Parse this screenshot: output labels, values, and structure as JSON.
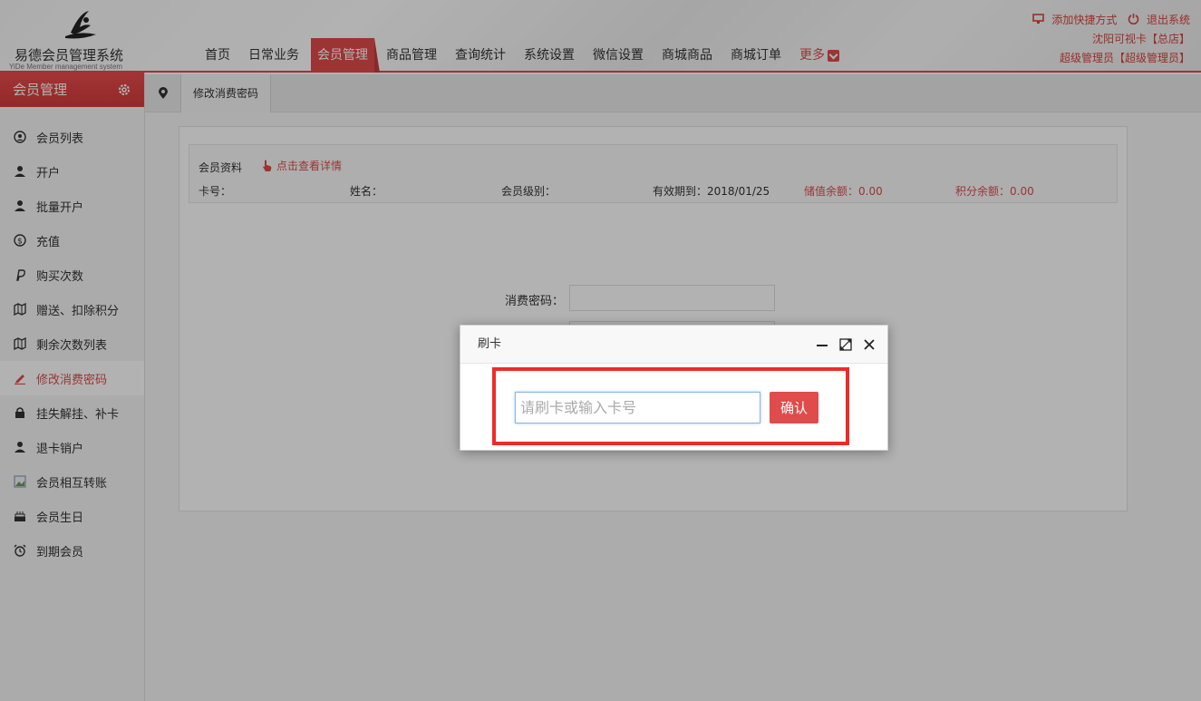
{
  "app": {
    "title": "易德会员管理系统",
    "subtitle": "YiDe Member management system"
  },
  "nav": {
    "items": [
      "首页",
      "日常业务",
      "会员管理",
      "商品管理",
      "查询统计",
      "系统设置",
      "微信设置",
      "商城商品",
      "商城订单"
    ],
    "active": "会员管理",
    "more": "更多"
  },
  "top_right": {
    "shortcut": "添加快捷方式",
    "logout": "退出系统",
    "store": "沈阳可视卡【总店】",
    "user": "超级管理员【超级管理员】"
  },
  "sidebar": {
    "title": "会员管理",
    "items": [
      {
        "label": "会员列表",
        "icon": "user-circle-icon"
      },
      {
        "label": "开户",
        "icon": "user-icon"
      },
      {
        "label": "批量开户",
        "icon": "user-icon"
      },
      {
        "label": "充值",
        "icon": "dollar-circle-icon"
      },
      {
        "label": "购买次数",
        "icon": "paypal-icon"
      },
      {
        "label": "赠送、扣除积分",
        "icon": "map-icon"
      },
      {
        "label": "剩余次数列表",
        "icon": "map-icon"
      },
      {
        "label": "修改消费密码",
        "icon": "pencil-icon",
        "active": true
      },
      {
        "label": "挂失解挂、补卡",
        "icon": "lock-icon"
      },
      {
        "label": "退卡销户",
        "icon": "user-icon"
      },
      {
        "label": "会员相互转账",
        "icon": "image-icon"
      },
      {
        "label": "会员生日",
        "icon": "cake-icon"
      },
      {
        "label": "到期会员",
        "icon": "alarm-icon"
      }
    ]
  },
  "tab": {
    "label": "修改消费密码"
  },
  "member_info": {
    "title": "会员资料",
    "detail_link": "点击查看详情",
    "card_no": "卡号：",
    "name": "姓名：",
    "level": "会员级别：",
    "expiry": "有效期到：2018/01/25",
    "stored_balance": "储值余额：0.00",
    "points_balance": "积分余额：0.00"
  },
  "form": {
    "password_label": "消费密码："
  },
  "dialog": {
    "title": "刷卡",
    "input_placeholder": "请刷卡或输入卡号",
    "confirm": "确认"
  },
  "colors": {
    "accent": "#e04b4b",
    "highlight": "#ee2b2b"
  }
}
